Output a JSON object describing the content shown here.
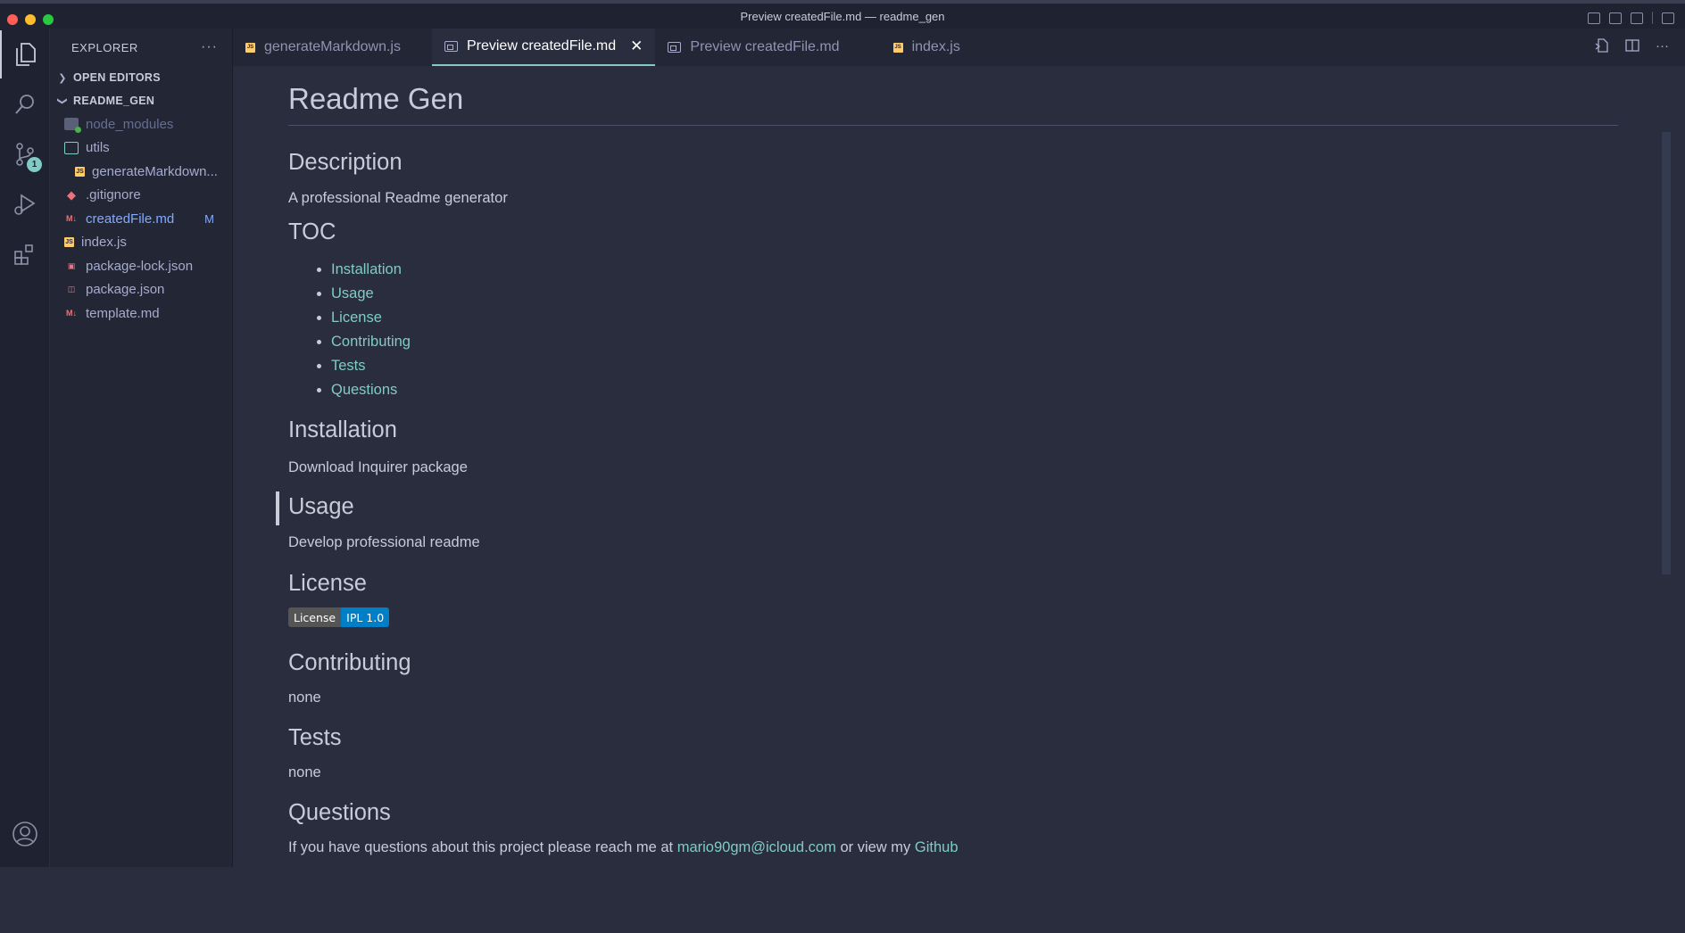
{
  "window": {
    "title": "Preview createdFile.md — readme_gen"
  },
  "activity_bar": {
    "source_control_badge": "1"
  },
  "sidebar": {
    "header": "EXPLORER",
    "open_editors_label": "OPEN EDITORS",
    "project_label": "README_GEN",
    "files": [
      {
        "name": "node_modules",
        "icon": "node-modules-folder-icon"
      },
      {
        "name": "utils",
        "icon": "folder-icon"
      },
      {
        "name": "generateMarkdown...",
        "icon": "js-file-icon"
      },
      {
        "name": ".gitignore",
        "icon": "git-icon"
      },
      {
        "name": "createdFile.md",
        "icon": "markdown-file-icon",
        "status": "M"
      },
      {
        "name": "index.js",
        "icon": "js-file-icon"
      },
      {
        "name": "package-lock.json",
        "icon": "lock-json-icon"
      },
      {
        "name": "package.json",
        "icon": "npm-json-icon"
      },
      {
        "name": "template.md",
        "icon": "markdown-file-icon"
      }
    ]
  },
  "tabs": [
    {
      "label": "generateMarkdown.js",
      "icon": "js-file-icon"
    },
    {
      "label": "Preview createdFile.md",
      "icon": "preview-icon",
      "active": true
    },
    {
      "label": "Preview createdFile.md",
      "icon": "preview-icon"
    },
    {
      "label": "index.js",
      "icon": "js-file-icon"
    }
  ],
  "preview": {
    "title": "Readme Gen",
    "description_heading": "Description",
    "description_text": "A professional Readme generator",
    "toc_heading": "TOC",
    "toc_items": [
      "Installation",
      "Usage",
      "License",
      "Contributing",
      "Tests",
      "Questions"
    ],
    "installation_heading": "Installation",
    "installation_text": "Download Inquirer package",
    "usage_heading": "Usage",
    "usage_text": "Develop professional readme",
    "license_heading": "License",
    "license_badge_left": "License",
    "license_badge_right": "IPL 1.0",
    "contributing_heading": "Contributing",
    "contributing_text": "none",
    "tests_heading": "Tests",
    "tests_text": "none",
    "questions_heading": "Questions",
    "questions_prefix": "If you have questions about this project please reach me at",
    "questions_email": "mario90gm@icloud.com",
    "questions_middle": "or view my",
    "questions_github": "Github"
  },
  "colors": {
    "accent": "#80cbc4",
    "background": "#292d3e",
    "sidebar": "#232634"
  }
}
